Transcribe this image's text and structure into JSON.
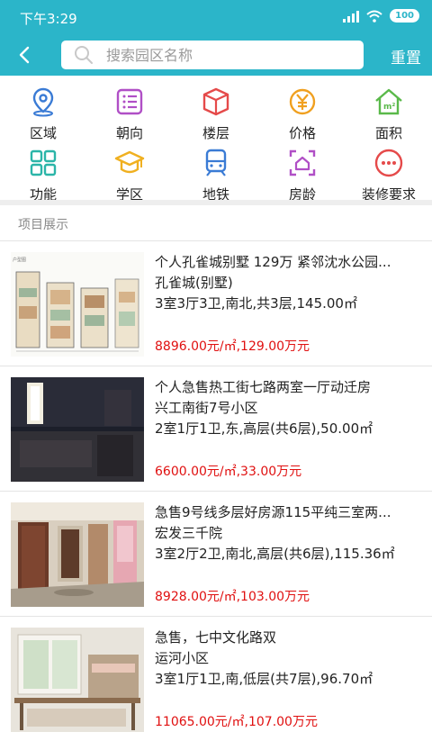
{
  "status": {
    "time": "下午3:29",
    "battery": "100"
  },
  "header": {
    "search_placeholder": "搜索园区名称",
    "reset_label": "重置"
  },
  "filters": [
    {
      "label": "区域",
      "icon": "location-pin-icon",
      "color": "#3a7bd5"
    },
    {
      "label": "朝向",
      "icon": "list-icon",
      "color": "#b04fc6"
    },
    {
      "label": "楼层",
      "icon": "cube-icon",
      "color": "#e54a4a"
    },
    {
      "label": "价格",
      "icon": "yen-icon",
      "color": "#f0a020"
    },
    {
      "label": "面积",
      "icon": "house-area-icon",
      "color": "#5ab94a"
    },
    {
      "label": "功能",
      "icon": "grid-icon",
      "color": "#2bb5a8"
    },
    {
      "label": "学区",
      "icon": "graduation-cap-icon",
      "color": "#f0b020"
    },
    {
      "label": "地铁",
      "icon": "metro-icon",
      "color": "#3a7bd5"
    },
    {
      "label": "房龄",
      "icon": "house-scan-icon",
      "color": "#b04fc6"
    },
    {
      "label": "装修要求",
      "icon": "more-icon",
      "color": "#e54a4a"
    }
  ],
  "section_title": "项目展示",
  "listings": [
    {
      "title": "个人孔雀城别墅 129万 紧邻沈水公园...",
      "community": "孔雀城(别墅)",
      "spec": "3室3厅3卫,南北,共3层,145.00㎡",
      "price": "8896.00元/㎡,129.00万元",
      "thumb": "floorplan"
    },
    {
      "title": "个人急售热工街七路两室一厅动迁房",
      "community": "兴工南街7号小区",
      "spec": "2室1厅1卫,东,高层(共6层),50.00㎡",
      "price": "6600.00元/㎡,33.00万元",
      "thumb": "dark-room"
    },
    {
      "title": "急售9号线多层好房源115平纯三室两...",
      "community": "宏发三千院",
      "spec": "3室2厅2卫,南北,高层(共6层),115.36㎡",
      "price": "8928.00元/㎡,103.00万元",
      "thumb": "hallway"
    },
    {
      "title": "急售，七中文化路双",
      "community": "运河小区",
      "spec": "3室1厅1卫,南,低层(共7层),96.70㎡",
      "price": "11065.00元/㎡,107.00万元",
      "thumb": "bedroom"
    }
  ]
}
